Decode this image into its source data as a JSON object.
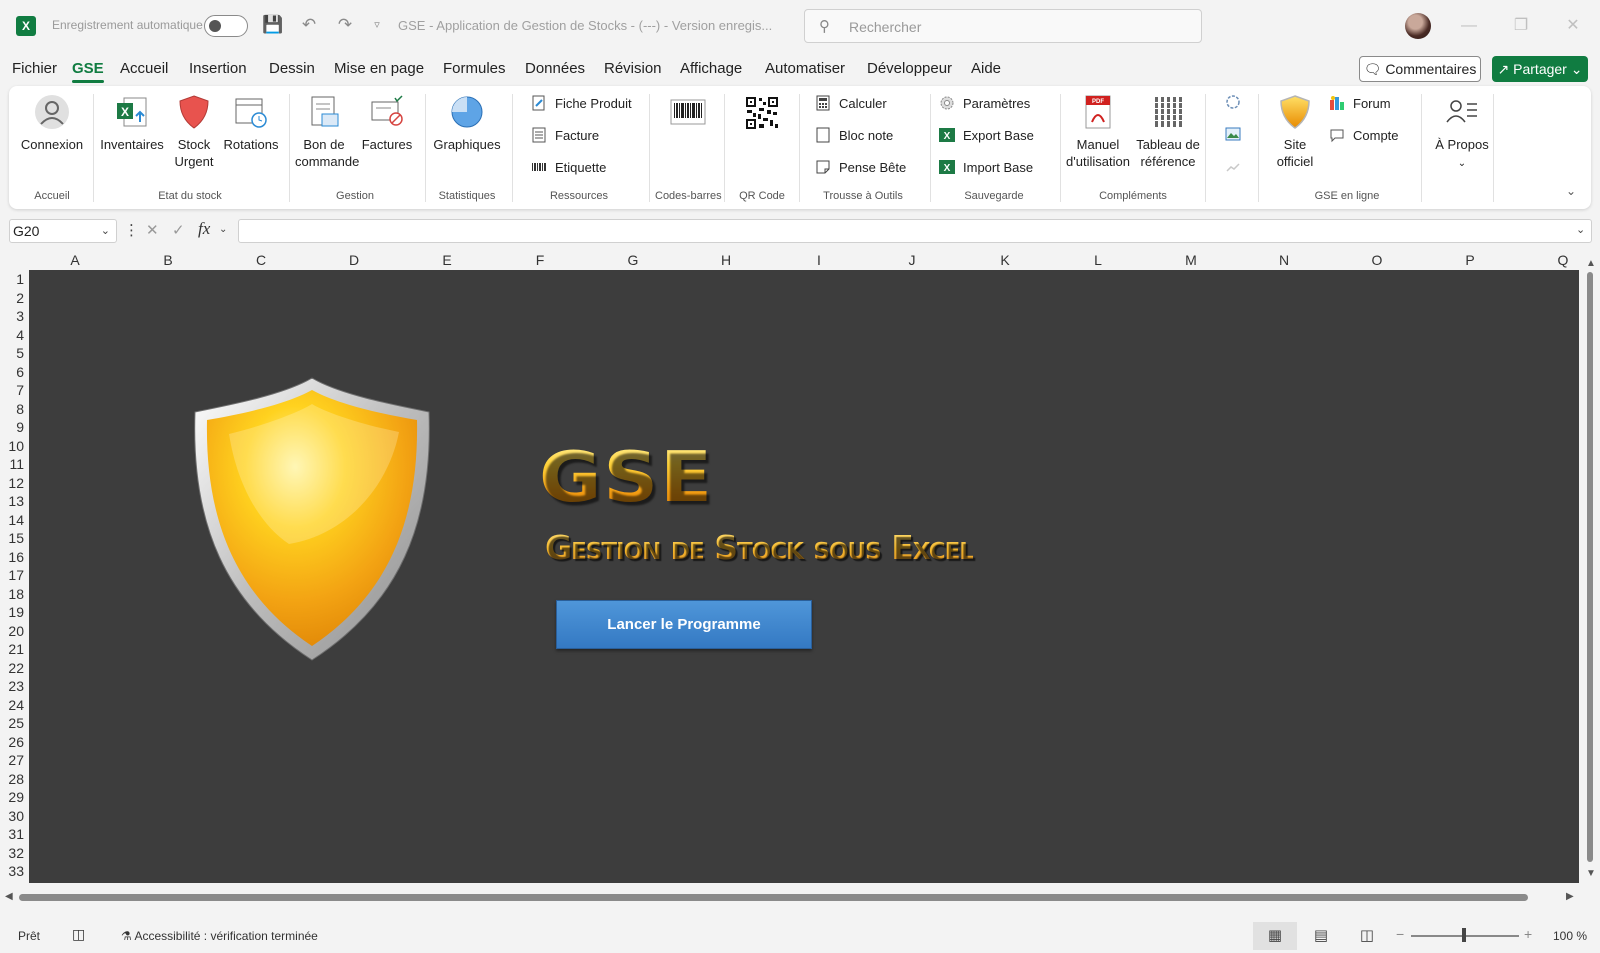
{
  "titlebar": {
    "app_icon": "X",
    "autosave_label": "Enregistrement automatique",
    "doc_title": "GSE - Application de Gestion de Stocks - (---) - Version enregis...",
    "search_placeholder": "Rechercher",
    "qa_icons": [
      "save-icon",
      "undo-icon",
      "redo-icon",
      "customize-icon"
    ]
  },
  "menu": {
    "tabs": [
      "Fichier",
      "GSE",
      "Accueil",
      "Insertion",
      "Dessin",
      "Mise en page",
      "Formules",
      "Données",
      "Révision",
      "Affichage",
      "Automatiser",
      "Développeur",
      "Aide"
    ],
    "active": "GSE",
    "comments": "Commentaires",
    "share": "Partager"
  },
  "ribbon": {
    "connexion": "Connexion",
    "inventaires": "Inventaires",
    "stock_urgent_1": "Stock",
    "stock_urgent_2": "Urgent",
    "rotations": "Rotations",
    "bon_1": "Bon de",
    "bon_2": "commande",
    "factures": "Factures",
    "graphiques": "Graphiques",
    "fiche_produit": "Fiche Produit",
    "facture": "Facture",
    "etiquette": "Etiquette",
    "calculer": "Calculer",
    "bloc_note": "Bloc note",
    "pense_bete": "Pense Bête",
    "parametres": "Paramètres",
    "export_base": "Export Base",
    "import_base": "Import Base",
    "manuel_1": "Manuel",
    "manuel_2": "d'utilisation",
    "tableau_1": "Tableau de",
    "tableau_2": "référence",
    "site_1": "Site",
    "site_2": "officiel",
    "forum": "Forum",
    "compte": "Compte",
    "apropos": "À Propos",
    "groups": {
      "accueil": "Accueil",
      "etat": "Etat du stock",
      "gestion": "Gestion",
      "statistiques": "Statistiques",
      "ressources": "Ressources",
      "codes": "Codes-barres",
      "qr": "QR Code",
      "trousse": "Trousse à Outils",
      "sauvegarde": "Sauvegarde",
      "complements": "Compléments",
      "enligne": "GSE en ligne"
    }
  },
  "formula_bar": {
    "name_box": "G20",
    "fx": "fx",
    "value": ""
  },
  "grid": {
    "columns": [
      "A",
      "B",
      "C",
      "D",
      "E",
      "F",
      "G",
      "H",
      "I",
      "J",
      "K",
      "L",
      "M",
      "N",
      "O",
      "P",
      "Q"
    ],
    "rows": [
      "1",
      "2",
      "3",
      "4",
      "5",
      "6",
      "7",
      "8",
      "9",
      "10",
      "11",
      "12",
      "13",
      "14",
      "15",
      "16",
      "17",
      "18",
      "19",
      "20",
      "21",
      "22",
      "23",
      "24",
      "25",
      "26",
      "27",
      "28",
      "29",
      "30",
      "31",
      "32",
      "33"
    ],
    "sheet_bg": "#3d3d3d"
  },
  "sheet": {
    "logo_text": "GSE",
    "subtitle": "Gestion de Stock sous Excel",
    "launch_button": "Lancer le Programme"
  },
  "status": {
    "ready": "Prêt",
    "accessibility": "Accessibilité : vérification terminée",
    "zoom": "100 %"
  },
  "colors": {
    "accent": "#107c41",
    "button_blue": "#3b82c8",
    "gold": "#f6b21a"
  }
}
